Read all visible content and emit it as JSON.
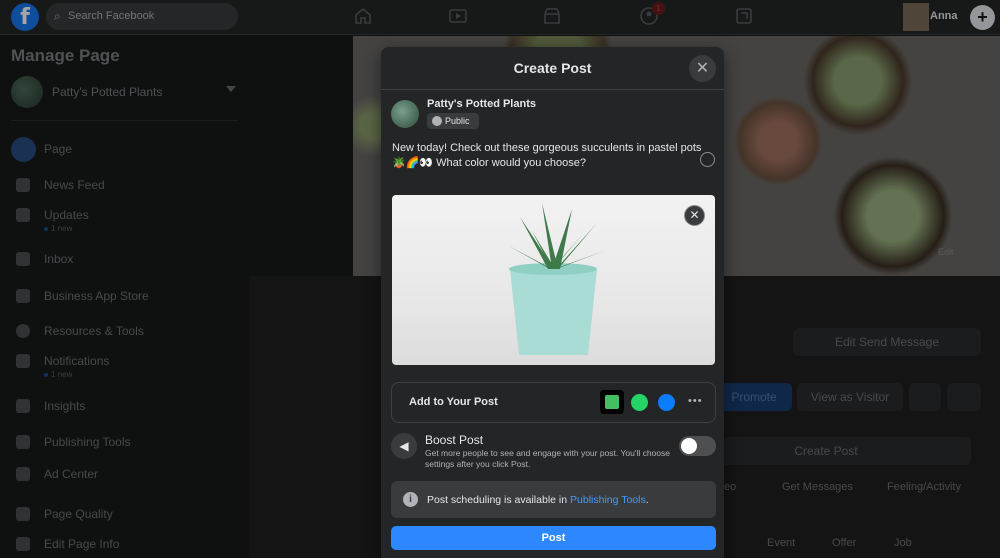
{
  "topbar": {
    "search_placeholder": "Search Facebook",
    "notification_count": "1",
    "user_name": "Anna",
    "logo_letter": "f"
  },
  "sidebar": {
    "title": "Manage Page",
    "page_name": "Patty's Potted Plants",
    "items": [
      {
        "label": "Page"
      },
      {
        "label": "News Feed"
      },
      {
        "label": "Updates",
        "sub": "1 new"
      },
      {
        "label": "Inbox"
      },
      {
        "label": "Business App Store"
      },
      {
        "label": "Resources & Tools"
      },
      {
        "label": "Notifications",
        "sub": "1 new"
      },
      {
        "label": "Insights"
      },
      {
        "label": "Publishing Tools"
      },
      {
        "label": "Ad Center"
      },
      {
        "label": "Page Quality"
      },
      {
        "label": "Edit Page Info"
      }
    ]
  },
  "background": {
    "cover_edit": "Edit",
    "edit_send_message": "Edit Send Message",
    "promote": "Promote",
    "view_as_visitor": "View as Visitor",
    "create_post": "Create Post",
    "get_messages": "Get Messages",
    "feeling_activity": "Feeling/Activity",
    "video_partial": "eo",
    "event": "Event",
    "offer": "Offer",
    "job": "Job"
  },
  "modal": {
    "title": "Create Post",
    "page_name": "Patty's Potted Plants",
    "audience": "Public",
    "post_text_line1": "New today! Check out these gorgeous succulents in pastel pots",
    "post_text_line2": "🪴🌈👀 What color would you choose?",
    "add_to_post": "Add to Your Post",
    "more": "•••",
    "boost_title": "Boost Post",
    "boost_desc": "Get more people to see and engage with your post. You'll choose settings after you click Post.",
    "boost_enabled": false,
    "schedule_text": "Post scheduling is available in",
    "schedule_link": "Publishing Tools",
    "schedule_end": ".",
    "post_button": "Post"
  }
}
